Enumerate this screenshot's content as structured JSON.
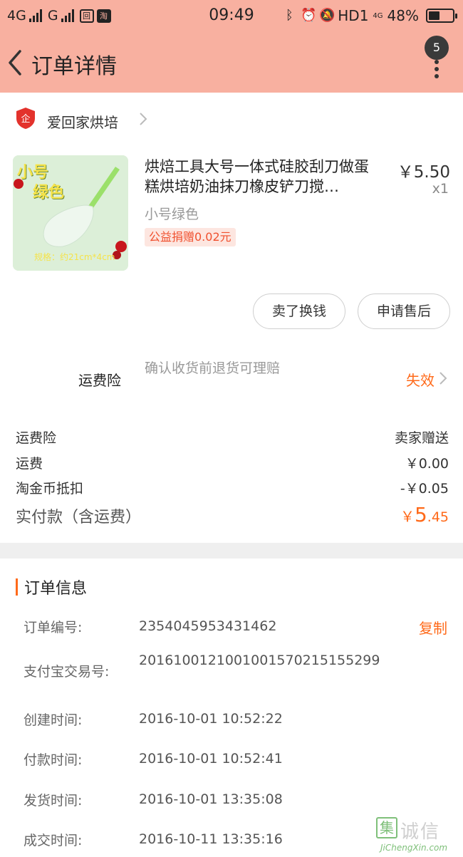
{
  "status_bar": {
    "net1": "4G",
    "net2": "G",
    "time": "09:49",
    "hd": "HD1",
    "lte_sup": "4G",
    "battery_pct_text": "48%",
    "battery_level": 0.48,
    "icons": [
      "signal-icon",
      "sim-icon",
      "taobao-notify-icon",
      "bluetooth-icon",
      "alarm-icon",
      "mute-icon",
      "battery-icon"
    ]
  },
  "nav": {
    "title": "订单详情",
    "badge_count": "5"
  },
  "store": {
    "name": "爱回家烘培"
  },
  "product": {
    "thumb_text1": "小号",
    "thumb_text2": "绿色",
    "thumb_caption": "规格：约21cm*4cm",
    "title": "烘焙工具大号一体式硅胶刮刀做蛋糕烘培奶油抹刀橡皮铲刀搅…",
    "price": "￥5.50",
    "qty": "x1",
    "sku": "小号绿色",
    "charity": "公益捐赠0.02元"
  },
  "actions": {
    "sell_label": "卖了换钱",
    "after_sale_label": "申请售后"
  },
  "insurance": {
    "label": "运费险",
    "desc": "确认收货前退货可理赔",
    "status": "失效"
  },
  "costs": [
    {
      "label": "运费险",
      "value": "卖家赠送"
    },
    {
      "label": "运费",
      "value": "￥0.00"
    },
    {
      "label": "淘金币抵扣",
      "value": "-￥0.05"
    }
  ],
  "total": {
    "label": "实付款（含运费）",
    "currency": "￥",
    "int": "5",
    "dec": ".45"
  },
  "order_info": {
    "title": "订单信息",
    "copy_label": "复制",
    "rows": [
      {
        "key": "订单编号:",
        "value": "2354045953431462"
      },
      {
        "key": "支付宝交易号:",
        "value": "2016100121001001570215155299"
      },
      {
        "key": "创建时间:",
        "value": "2016-10-01 10:52:22"
      },
      {
        "key": "付款时间:",
        "value": "2016-10-01 10:52:41"
      },
      {
        "key": "发货时间:",
        "value": "2016-10-01 13:35:08"
      },
      {
        "key": "成交时间:",
        "value": "2016-10-11 13:35:16"
      }
    ]
  },
  "watermark": {
    "mark": "集",
    "text": "诚信",
    "url": "JiChengXin.com"
  },
  "colors": {
    "header_bg": "#f8b0a0",
    "accent": "#ff6a1a",
    "divider": "#efefef"
  }
}
